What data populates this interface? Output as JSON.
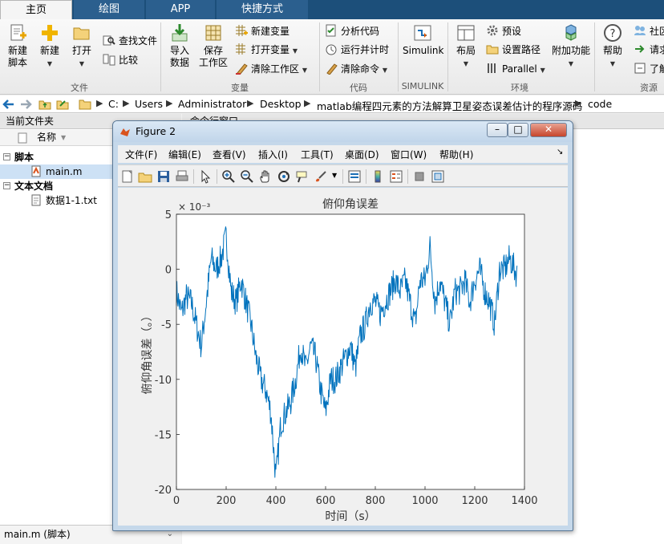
{
  "tabs": [
    {
      "label": "主页",
      "state": "active"
    },
    {
      "label": "绘图",
      "state": "inactive"
    },
    {
      "label": "APP",
      "state": "inactive"
    },
    {
      "label": "快捷方式",
      "state": "inactive"
    }
  ],
  "ribbon": {
    "file": {
      "group_label": "文件",
      "new_script": [
        "新建",
        "脚本"
      ],
      "new": "新建",
      "open": "打开",
      "find_files": "查找文件",
      "compare": "比较"
    },
    "variable": {
      "group_label": "变量",
      "import_data": [
        "导入",
        "数据"
      ],
      "save_workspace": [
        "保存",
        "工作区"
      ],
      "new_variable": "新建变量",
      "open_variable": "打开变量",
      "clear_workspace": "清除工作区"
    },
    "code": {
      "group_label": "代码",
      "analyze_code": "分析代码",
      "run_and_time": "运行并计时",
      "clear_commands": "清除命令"
    },
    "simulink": {
      "group_label": "SIMULINK",
      "simulink": "Simulink"
    },
    "environment": {
      "group_label": "环境",
      "layout": "布局",
      "preferences": "预设",
      "set_path": "设置路径",
      "parallel": "Parallel",
      "addons": "附加功能"
    },
    "resources": {
      "group_label": "资源",
      "help": "帮助",
      "community": "社区",
      "request_support": "请求",
      "learn": "了解"
    }
  },
  "address": {
    "crumbs": [
      "C:",
      "Users",
      "Administrator",
      "Desktop",
      "matlab编程四元素的方法解算卫星姿态误差估计的程序源码",
      "code"
    ]
  },
  "left_panel": {
    "title": "当前文件夹",
    "column_name": "名称",
    "groups": [
      {
        "label": "脚本",
        "files": [
          "main.m"
        ]
      },
      {
        "label": "文本文档",
        "files": [
          "数据1-1.txt"
        ]
      }
    ],
    "detail": "main.m  (脚本)"
  },
  "command_window": {
    "title": "命令行窗口"
  },
  "figure": {
    "title": "Figure 2",
    "menus": [
      "文件(F)",
      "编辑(E)",
      "查看(V)",
      "插入(I)",
      "工具(T)",
      "桌面(D)",
      "窗口(W)",
      "帮助(H)"
    ]
  },
  "colors": {
    "tab_strip": "#1c4f7a",
    "plot_line": "#0072bd",
    "selected_row": "#cde1f5"
  },
  "chart_data": {
    "type": "line",
    "title": "俯仰角误差",
    "xlabel": "时间（s）",
    "ylabel": "俯仰角误差（。）",
    "exponent_label": "× 10⁻³",
    "xlim": [
      0,
      1400
    ],
    "ylim": [
      -20,
      5
    ],
    "xticks": [
      0,
      200,
      400,
      600,
      800,
      1000,
      1200,
      1400
    ],
    "yticks": [
      5,
      0,
      -5,
      -10,
      -15,
      -20
    ],
    "grid": false,
    "series": [
      {
        "x": [
          0,
          20,
          40,
          60,
          80,
          100,
          120,
          140,
          160,
          180,
          200,
          220,
          240,
          260,
          280,
          300,
          320,
          340,
          360,
          380,
          400,
          420,
          440,
          460,
          480,
          500,
          520,
          540,
          560,
          580,
          600,
          620,
          640,
          660,
          680,
          700,
          720,
          740,
          760,
          780,
          800,
          820,
          840,
          860,
          880,
          900,
          920,
          940,
          960,
          980,
          1000,
          1020,
          1040,
          1060,
          1080,
          1100,
          1120,
          1140,
          1160,
          1180,
          1200,
          1220,
          1240,
          1260,
          1280,
          1300,
          1320,
          1340,
          1360,
          1370
        ],
        "y": [
          -2,
          -4,
          -2.5,
          -3,
          -5,
          -7,
          -3,
          1,
          0,
          1,
          3,
          -2,
          -3,
          -1,
          -3,
          -5,
          -8,
          -10,
          -11,
          -13,
          -19,
          -14,
          -13,
          -12,
          -10,
          -7,
          -9,
          -7,
          -8,
          -11,
          -13,
          -10,
          -10,
          -9,
          -8,
          -7,
          -9,
          -6,
          -5,
          -3,
          -3,
          -4,
          -3,
          -2,
          -1,
          -2,
          -1,
          -3,
          -5,
          -1,
          -1,
          2,
          -3,
          -1,
          -3,
          -5,
          -2,
          -2,
          -1,
          -3,
          -1,
          0,
          -2,
          -3,
          -5,
          0,
          0,
          1,
          0,
          -0.5
        ],
        "noise_amplitude": 1.3
      }
    ]
  }
}
